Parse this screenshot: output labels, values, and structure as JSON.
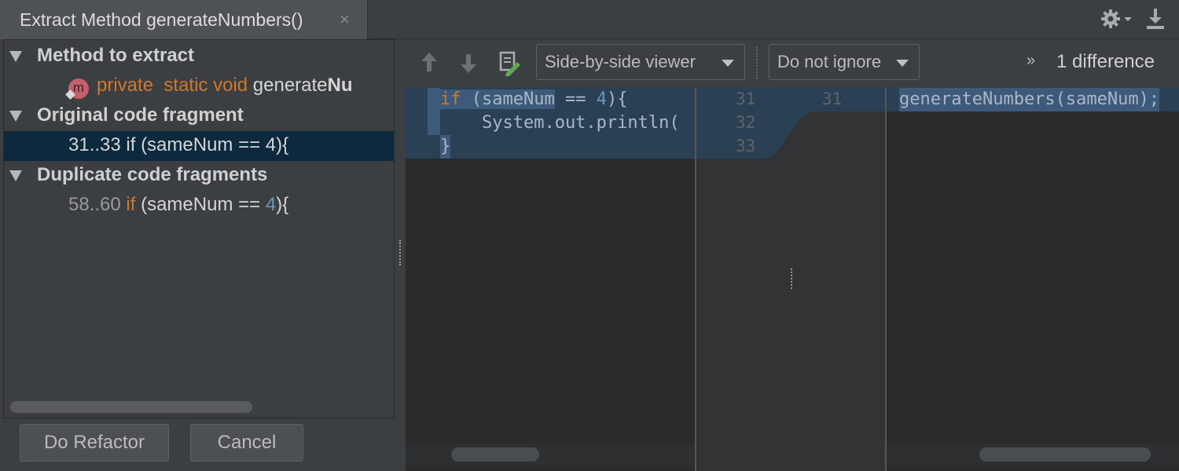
{
  "window": {
    "title": "Extract Method generateNumbers()",
    "close_glyph": "×",
    "settings_icon": "gear-icon",
    "download_icon": "download-icon"
  },
  "tree": {
    "method_header": "Method to extract",
    "signature": {
      "kw1": "private",
      "kw2": "static",
      "kw3": "void",
      "name_start": "generate",
      "name_bold": "Nu"
    },
    "method_icon_letter": "m",
    "original_header": "Original code fragment",
    "original_item": "31..33 if (sameNum == 4){",
    "duplicate_header": "Duplicate code fragments",
    "duplicate_item": {
      "range": "58..60",
      "kw": "if",
      "mid": "(sameNum ==",
      "num": "4",
      "end": "){"
    }
  },
  "buttons": {
    "refactor": "Do Refactor",
    "cancel": "Cancel"
  },
  "diff": {
    "viewer_combo": "Side-by-side viewer",
    "ignore_combo": "Do not ignore",
    "chevron": "»",
    "difference_count": "1 difference",
    "left_code": {
      "line1_kw": "if",
      "line1_sel": "(sameNum",
      "line1_mid": " == ",
      "line1_num": "4",
      "line1_end": "){",
      "line2": "    System.out.println(",
      "line3": "}"
    },
    "gutter_left": [
      "31",
      "32",
      "33"
    ],
    "gutter_right": [
      "31"
    ],
    "right_code": {
      "name": "generateNumbers",
      "args": "(sameNum);"
    }
  },
  "colors": {
    "keyword": "#cc7832",
    "number": "#6897bb",
    "selection": "#0d293e",
    "diff_highlight": "#294055"
  }
}
